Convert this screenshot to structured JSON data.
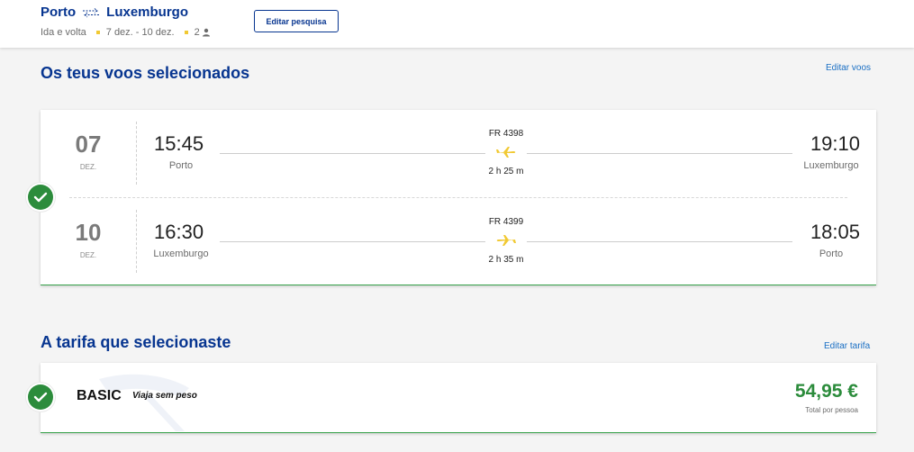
{
  "header": {
    "origin": "Porto",
    "destination": "Luxemburgo",
    "trip_type": "Ida e volta",
    "dates": "7 dez. - 10 dez.",
    "passengers": "2",
    "edit_search_label": "Editar pesquisa"
  },
  "flights_section": {
    "title": "Os teus voos selecionados",
    "edit_label": "Editar voos",
    "legs": [
      {
        "day": "07",
        "month": "DEZ.",
        "departure_time": "15:45",
        "departure_city": "Porto",
        "flight_number": "FR 4398",
        "duration": "2 h 25 m",
        "arrival_time": "19:10",
        "arrival_city": "Luxemburgo"
      },
      {
        "day": "10",
        "month": "DEZ.",
        "departure_time": "16:30",
        "departure_city": "Luxemburgo",
        "flight_number": "FR 4399",
        "duration": "2 h 35 m",
        "arrival_time": "18:05",
        "arrival_city": "Porto"
      }
    ]
  },
  "fare_section": {
    "title": "A tarifa que selecionaste",
    "edit_label": "Editar tarifa",
    "fare_name": "BASIC",
    "fare_tagline": "Viaja sem peso",
    "price": "54,95 €",
    "price_note": "Total por pessoa"
  },
  "colors": {
    "brand_blue": "#073590",
    "link_blue": "#1a6fc4",
    "success_green": "#2c8c3c",
    "accent_yellow": "#f1c933"
  },
  "icons": {
    "swap": "swap-arrows-icon",
    "passenger": "person-icon",
    "plane": "airplane-icon",
    "check": "check-circle-icon"
  }
}
